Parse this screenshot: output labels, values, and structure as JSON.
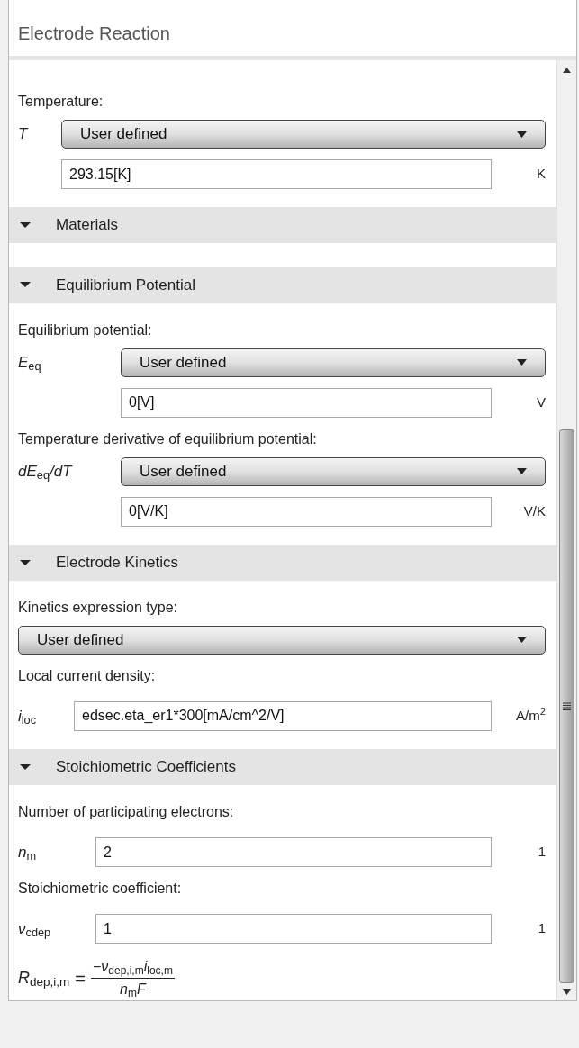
{
  "panel": {
    "title": "Electrode Reaction"
  },
  "sections": [
    {
      "items": [
        {
          "kind": "label",
          "text": "Temperature:"
        },
        {
          "kind": "dropdown",
          "symbol": "*T*",
          "value": "User defined"
        },
        {
          "kind": "field",
          "value": "293.15[K]",
          "unit": "K"
        }
      ]
    },
    {
      "title": "Materials",
      "expanded": true
    },
    {
      "title": "Equilibrium Potential",
      "expanded": true,
      "items": [
        {
          "kind": "label",
          "text": "Equilibrium potential:"
        },
        {
          "kind": "dropdown",
          "symbol": "*E*$_{eq}$",
          "value": "User defined"
        },
        {
          "kind": "field",
          "value": "0[V]",
          "unit": "V"
        },
        {
          "kind": "label",
          "text": "Temperature derivative of equilibrium potential:"
        },
        {
          "kind": "dropdown",
          "symbol": "*dE*$_{eq}$*/dT*",
          "value": "User defined"
        },
        {
          "kind": "field",
          "value": "0[V/K]",
          "unit": "V/K"
        }
      ]
    },
    {
      "title": "Electrode Kinetics",
      "expanded": true,
      "items": [
        {
          "kind": "label",
          "text": "Kinetics expression type:"
        },
        {
          "kind": "dropdown",
          "value": "User defined"
        },
        {
          "kind": "label",
          "text": "Local current density:"
        },
        {
          "kind": "field",
          "symbol": "*i*$_{loc}$",
          "value": "edsec.eta_er1*300[mA/cm^2/V]",
          "unit": "A/m$^{2}$"
        }
      ]
    },
    {
      "title": "Stoichiometric Coefficients",
      "expanded": true,
      "items": [
        {
          "kind": "label",
          "text": "Number of participating electrons:"
        },
        {
          "kind": "field",
          "symbol": "*n*$_{m}$",
          "value": "2",
          "unit": "1"
        },
        {
          "kind": "label",
          "text": "Stoichiometric coefficient:"
        },
        {
          "kind": "field",
          "symbol": "*ν*$_{cdep}$",
          "value": "1",
          "unit": "1"
        },
        {
          "kind": "equation",
          "lhs": "*R*$_{dep,i,m}$",
          "operator": "=",
          "numerator": "−*ν*$_{dep,i,m}$*i*$_{loc,m}$",
          "denominator": "*n*$_{m}$*F*"
        }
      ]
    }
  ]
}
